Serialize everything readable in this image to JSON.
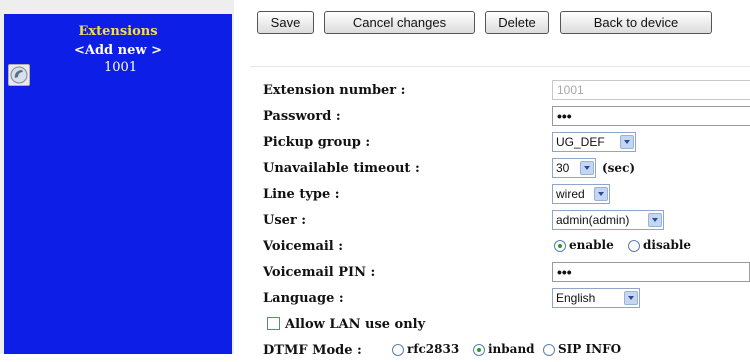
{
  "sidebar": {
    "title": "Extensions",
    "add_new": "<Add new >",
    "extensions": [
      {
        "number": "1001",
        "icon": "phone-icon"
      }
    ]
  },
  "toolbar": {
    "save": "Save",
    "cancel": "Cancel changes",
    "delete": "Delete",
    "back": "Back to device"
  },
  "form": {
    "extension_number": {
      "label": "Extension number :",
      "value": "1001"
    },
    "password": {
      "label": "Password :",
      "value": "•••"
    },
    "pickup_group": {
      "label": "Pickup group :",
      "value": "UG_DEF"
    },
    "unavailable_timeout": {
      "label": "Unavailable timeout :",
      "value": "30",
      "unit": "(sec)"
    },
    "line_type": {
      "label": "Line type :",
      "value": "wired"
    },
    "user": {
      "label": "User :",
      "value": "admin(admin)"
    },
    "voicemail": {
      "label": "Voicemail :",
      "options": [
        "enable",
        "disable"
      ],
      "selected": "enable"
    },
    "voicemail_pin": {
      "label": "Voicemail PIN :",
      "value": "•••"
    },
    "language": {
      "label": "Language :",
      "value": "English"
    },
    "allow_lan": {
      "label": "Allow LAN use only",
      "checked": false
    },
    "dtmf_mode": {
      "label": "DTMF Mode :",
      "options": [
        "rfc2833",
        "inband",
        "SIP INFO"
      ],
      "selected": "inband"
    }
  },
  "colors": {
    "sidebar_bg": "#0d1ee6",
    "sidebar_title": "#f3df4a",
    "radio_selected": "#2a9a2a"
  }
}
